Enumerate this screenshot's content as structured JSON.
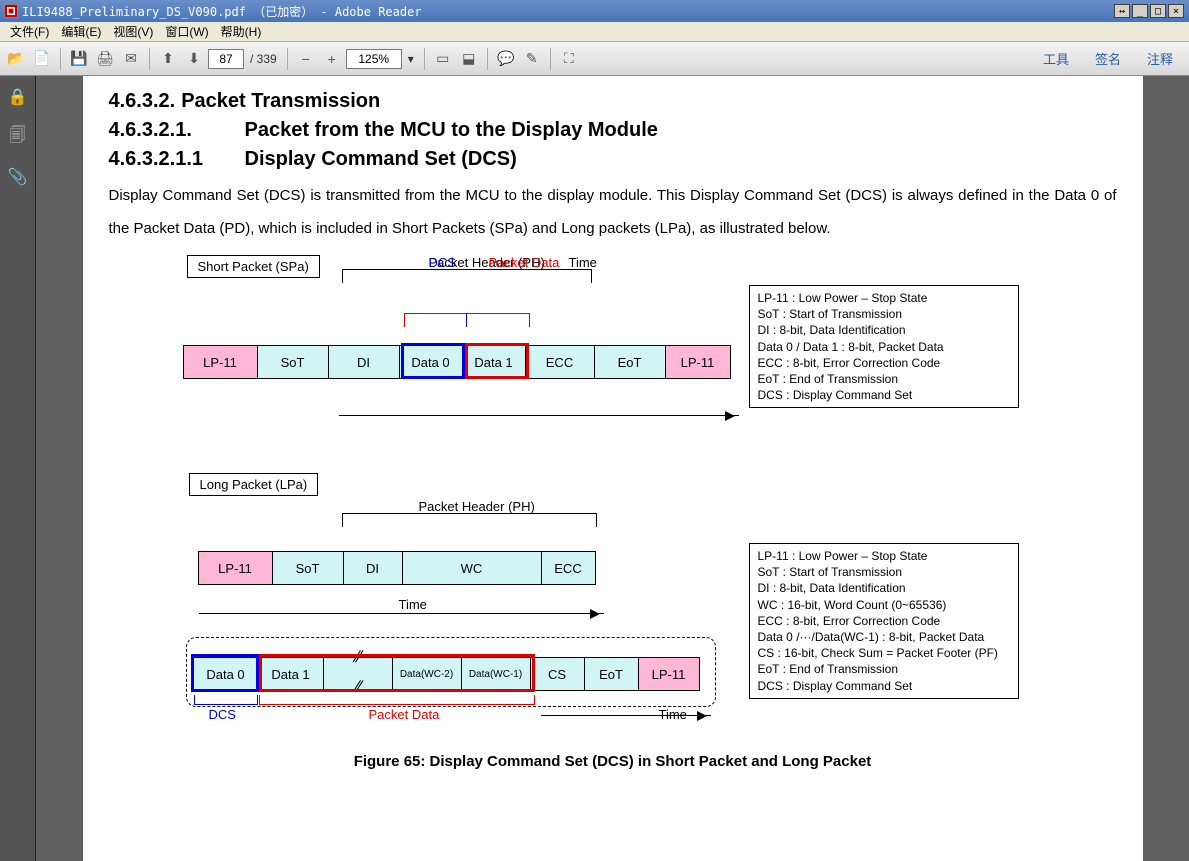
{
  "title": "ILI9488_Preliminary_DS_V090.pdf （已加密） - Adobe Reader",
  "menu": {
    "file": "文件(F)",
    "edit": "编辑(E)",
    "view": "视图(V)",
    "window": "窗口(W)",
    "help": "帮助(H)"
  },
  "toolbar": {
    "page": "87",
    "total": "/ 339",
    "zoom": "125%",
    "tools": "工具",
    "sign": "签名",
    "comment": "注释"
  },
  "doc": {
    "h1": {
      "num": "4.6.3.2.",
      "txt": "Packet Transmission"
    },
    "h2": {
      "num": "4.6.3.2.1.",
      "txt": "Packet from the MCU to the Display Module"
    },
    "h3": {
      "num": "4.6.3.2.1.1",
      "txt": "Display Command Set (DCS)"
    },
    "para": "Display Command Set (DCS) is transmitted from the MCU to the display module. This Display Command Set (DCS) is always defined in the Data 0 of the Packet Data (PD), which is included in Short Packets (SPa) and Long packets (LPa), as illustrated below.",
    "spa": {
      "lbl": "Short Packet (SPa)",
      "ph": "Packet Header (PH)",
      "dcs": "DCS",
      "pd": "Packet Data",
      "cells": [
        "LP-11",
        "SoT",
        "DI",
        "Data 0",
        "Data 1",
        "ECC",
        "EoT",
        "LP-11"
      ],
      "time": "Time"
    },
    "leg1": [
      "LP-11 : Low Power – Stop State",
      "SoT : Start of Transmission",
      "DI : 8-bit, Data Identification",
      "Data 0 / Data 1 : 8-bit, Packet Data",
      "ECC : 8-bit, Error Correction Code",
      "EoT : End of Transmission",
      "DCS : Display Command Set"
    ],
    "lpa": {
      "lbl": "Long Packet (LPa)",
      "ph": "Packet Header (PH)",
      "cells1": [
        "LP-11",
        "SoT",
        "DI",
        "WC",
        "ECC"
      ],
      "time1": "Time",
      "cells2": [
        "Data 0",
        "Data 1",
        "",
        "Data(WC-2)",
        "Data(WC-1)",
        "CS",
        "EoT",
        "LP-11"
      ],
      "dcs": "DCS",
      "pd": "Packet Data",
      "time2": "Time"
    },
    "leg2": [
      "LP-11 : Low Power – Stop State",
      "SoT : Start of Transmission",
      "DI : 8-bit, Data Identification",
      "WC : 16-bit, Word Count (0~65536)",
      "ECC : 8-bit, Error Correction Code",
      "Data 0 /···/Data(WC-1) : 8-bit, Packet Data",
      "CS : 16-bit, Check Sum = Packet Footer (PF)",
      "EoT : End of Transmission",
      "DCS : Display Command Set"
    ],
    "figcap": "Figure 65: Display Command Set (DCS) in Short Packet and Long Packet"
  }
}
